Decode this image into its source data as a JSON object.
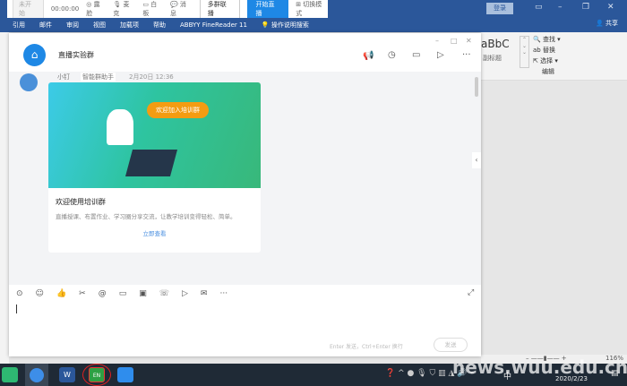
{
  "live_toolbar": {
    "status": "未开始",
    "timer": "00:00:00",
    "items": [
      "露脸",
      "麦克",
      "白板",
      "消息"
    ],
    "multi": "多群联播",
    "start": "开始直播",
    "switch": "切换模式"
  },
  "word": {
    "login": "登录",
    "share": "共享",
    "tabs": [
      "引用",
      "邮件",
      "审阅",
      "视图",
      "加载项",
      "帮助",
      "ABBYY FineReader 11",
      "操作说明搜索"
    ],
    "styles_preview": "aBbC",
    "styles_label": "副标题",
    "edit_items": [
      "查找",
      "替换",
      "选择"
    ],
    "edit_group": "编辑",
    "zoom": "116%"
  },
  "chat": {
    "title": "直播实验群",
    "sender": "小钉",
    "sender_tag": "智能群助手",
    "time": "2月20日 12:36",
    "banner_text": "欢迎加入培训群",
    "card_title": "欢迎使用培训群",
    "card_desc": "直播授课、布置作业、学习圈分享交流，让教学培训变得轻松、简单。",
    "card_link": "立即查看",
    "hint": "Enter 发送，Ctrl+Enter 换行",
    "send": "发送"
  },
  "taskbar": {
    "date": "2020/2/23",
    "ime": "中",
    "app_badge": "EN",
    "watermark": "news.wuu.edu.cn"
  }
}
